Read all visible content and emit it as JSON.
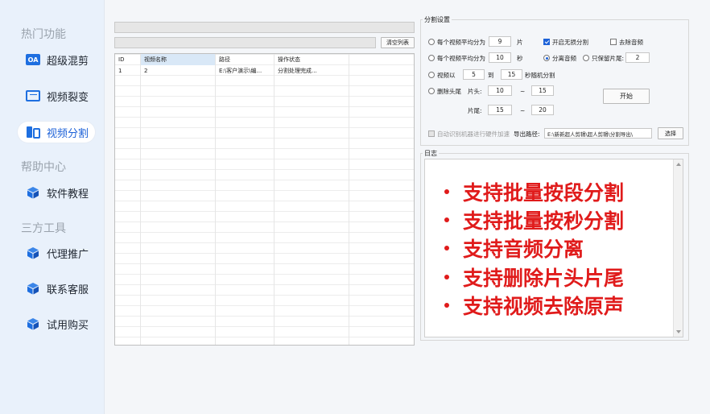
{
  "sidebar": {
    "section_hot": "热门功能",
    "section_help": "帮助中心",
    "section_tools": "三方工具",
    "items": [
      {
        "label": "超级混剪",
        "icon": "oa-icon",
        "icon_text": "OA"
      },
      {
        "label": "视频裂变",
        "icon": "monitor-icon"
      },
      {
        "label": "视频分割",
        "icon": "split-icon",
        "active": true
      },
      {
        "label": "软件教程",
        "icon": "cube-icon"
      },
      {
        "label": "代理推广",
        "icon": "cube-icon"
      },
      {
        "label": "联系客服",
        "icon": "cube-icon"
      },
      {
        "label": "试用购买",
        "icon": "cube-icon"
      }
    ]
  },
  "toolbar": {
    "clear_list_label": "清空列表"
  },
  "table": {
    "columns": [
      "ID",
      "视频名称",
      "路径",
      "操作状态"
    ],
    "rows": [
      [
        "1",
        "2",
        "E:\\客户演示\\编...",
        "分割处理完成..."
      ]
    ]
  },
  "settings": {
    "title": "分割设置",
    "opt_even_split": "每个视频平均分为",
    "even_split_count": "9",
    "unit_pieces": "片",
    "seamless_label": "开启无损分割",
    "remove_audio_label": "去除音频",
    "opt_seconds_split": "每个视频平均分为",
    "seconds_value": "10",
    "unit_seconds": "秒",
    "separate_audio_label": "分离音频",
    "keep_tail_label": "只保留片尾:",
    "keep_tail_value": "2",
    "opt_random": "视频以",
    "random_min": "5",
    "random_to": "到",
    "random_max": "15",
    "random_suffix": "秒随机分割",
    "opt_trim": "删除头尾",
    "head_label": "片头:",
    "head_min": "10",
    "head_dash": "~",
    "head_max": "15",
    "tail_label": "片尾:",
    "tail_min": "15",
    "tail_dash": "~",
    "tail_max": "20",
    "start_label": "开始",
    "hw_accel_label": "自动识别机器进行硬件加速",
    "export_label": "导出路径:",
    "export_path": "E:\\新新超人剪辑\\超人剪辑\\分割导出\\",
    "browse_label": "选择"
  },
  "log": {
    "title": "日志",
    "lines": [
      "支持批量按段分割",
      "支持批量按秒分割",
      "支持音频分离",
      "支持删除片头片尾",
      "支持视频去除原声"
    ]
  },
  "colors": {
    "accent": "#1d62d8",
    "highlight_text": "#e01b1b",
    "sidebar_bg": "#e9f1fb"
  }
}
